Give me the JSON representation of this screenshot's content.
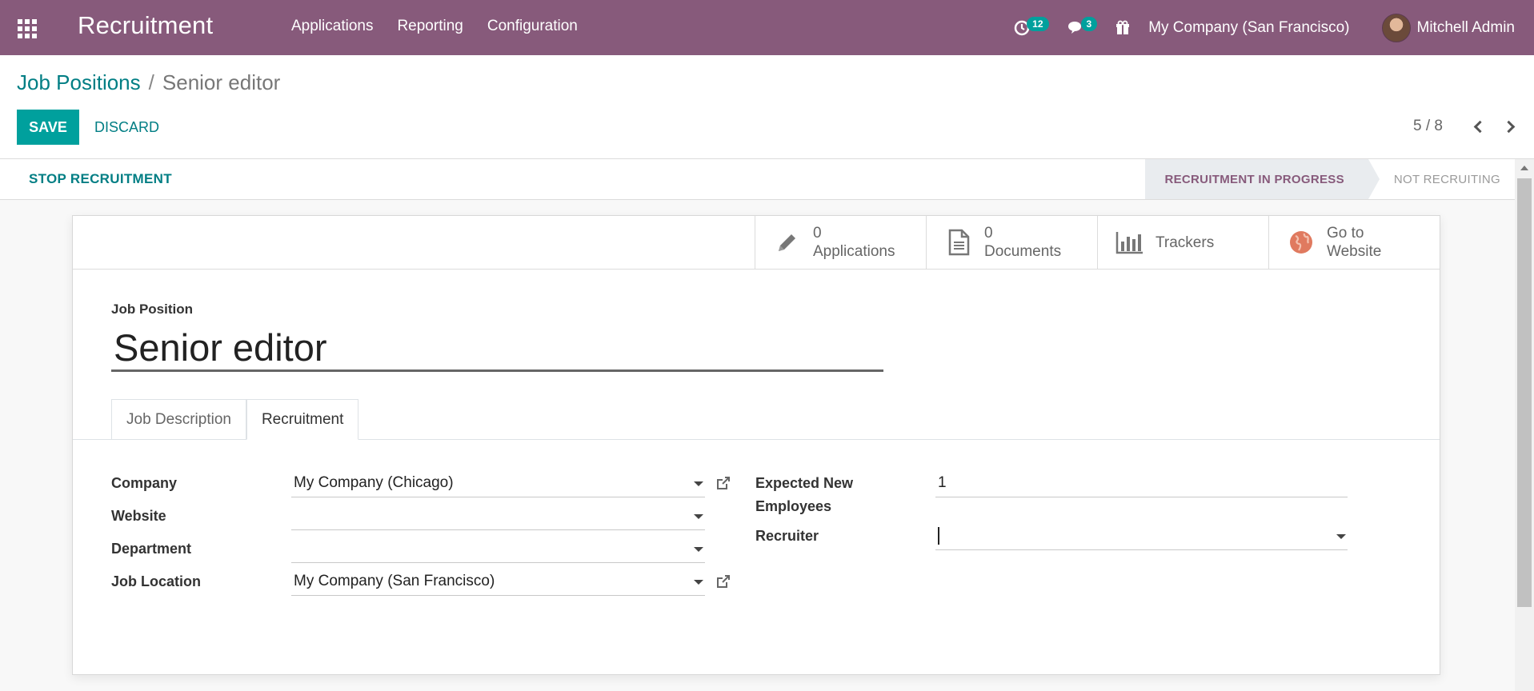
{
  "navbar": {
    "app_title": "Recruitment",
    "menu": [
      "Applications",
      "Reporting",
      "Configuration"
    ],
    "activity_badge": "12",
    "messages_badge": "3",
    "company": "My Company (San Francisco)",
    "user": "Mitchell Admin",
    "color": "#875a7b"
  },
  "breadcrumb": {
    "parent": "Job Positions",
    "separator": "/",
    "current": "Senior editor"
  },
  "actions": {
    "save": "SAVE",
    "discard": "DISCARD"
  },
  "pager": {
    "value": "5 / 8"
  },
  "statusbar": {
    "stop_button": "STOP RECRUITMENT",
    "stage_active": "RECRUITMENT IN PROGRESS",
    "stage_inactive": "NOT RECRUITING"
  },
  "smart_buttons": [
    {
      "count": "0",
      "label": "Applications",
      "icon": "pencil-icon"
    },
    {
      "count": "0",
      "label": "Documents",
      "icon": "document-icon"
    },
    {
      "count": "",
      "label": "Trackers",
      "icon": "bar-chart-icon"
    },
    {
      "count": "Go to",
      "label": "Website",
      "icon": "globe-icon"
    }
  ],
  "form": {
    "title_label": "Job Position",
    "title_value": "Senior editor",
    "tabs": [
      "Job Description",
      "Recruitment"
    ],
    "active_tab": "Recruitment",
    "fields": {
      "company_label": "Company",
      "company_value": "My Company (Chicago)",
      "website_label": "Website",
      "website_value": "",
      "department_label": "Department",
      "department_value": "",
      "job_location_label": "Job Location",
      "job_location_value": "My Company (San Francisco)",
      "expected_label_line1": "Expected New",
      "expected_label_line2": "Employees",
      "expected_value": "1",
      "recruiter_label": "Recruiter",
      "recruiter_value": ""
    }
  },
  "colors": {
    "accent": "#00a09d",
    "link": "#017e84",
    "brand": "#875a7b"
  }
}
